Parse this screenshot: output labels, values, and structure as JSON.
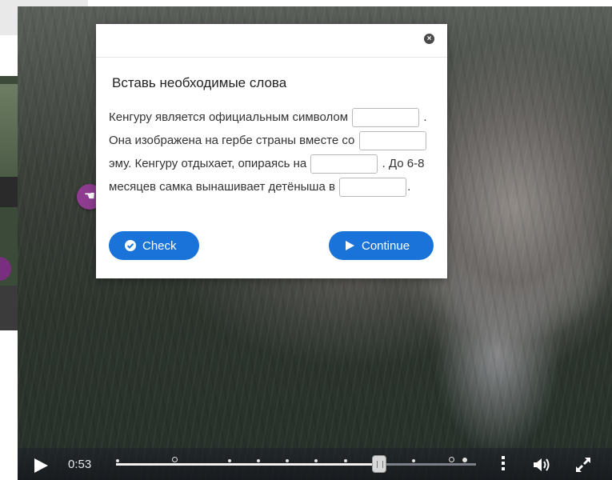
{
  "dialog": {
    "title": "Вставь необходимые слова",
    "sentence": {
      "s1": "Кенгуру является официальным символом",
      "s2": ". Она изображена на гербе страны вместе со",
      "s3": "эму. Кенгуру отдыхает, опираясь на",
      "s4": ". До 6-8 месяцев самка вынашивает детёныша в",
      "s5": "."
    },
    "blanks": [
      "",
      "",
      "",
      ""
    ],
    "check_label": "Check",
    "continue_label": "Continue",
    "close_icon": "close-icon"
  },
  "player": {
    "time": "0:53",
    "progress_fraction": 0.73,
    "icons": [
      "play-icon",
      "menu-icon",
      "volume-icon",
      "fullscreen-icon"
    ]
  },
  "colors": {
    "button": "#1a73d9",
    "handle": "#8e3c8f"
  }
}
